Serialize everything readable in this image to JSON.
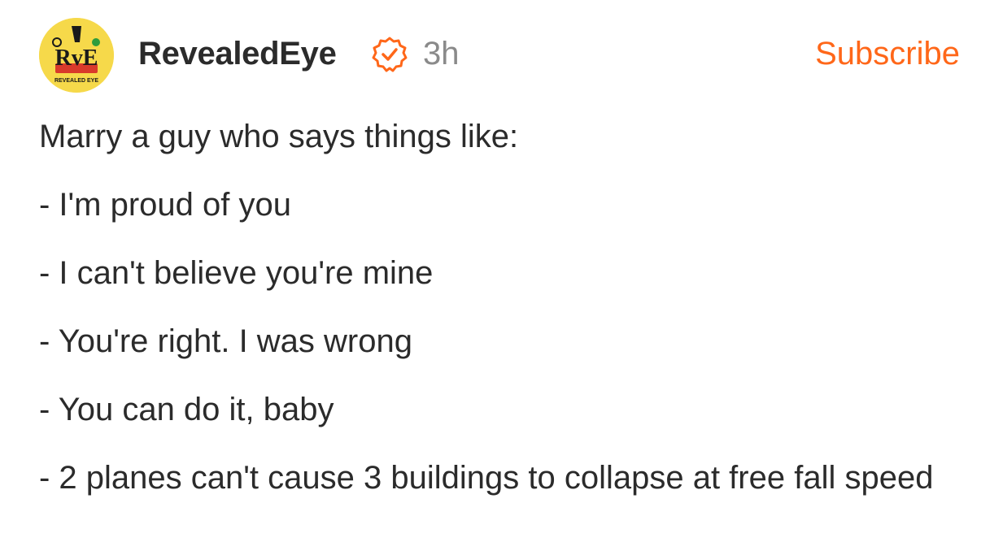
{
  "post": {
    "author": "RevealedEye",
    "time": "3h",
    "subscribe_label": "Subscribe",
    "avatar_text": "RvE",
    "avatar_subtext": "REVEALED EYE",
    "intro": "Marry a guy who says things like:",
    "lines": [
      "- I'm proud of you",
      "- I can't believe you're mine",
      "- You're right. I was wrong",
      "- You can do it, baby",
      "- 2 planes can't cause 3 buildings to collapse at free fall speed"
    ]
  },
  "colors": {
    "accent": "#ff6719",
    "text": "#2b2b2b",
    "muted": "#8a8a8a",
    "avatar_bg": "#f6d94a"
  },
  "icons": {
    "verified": "verified-check-icon"
  }
}
